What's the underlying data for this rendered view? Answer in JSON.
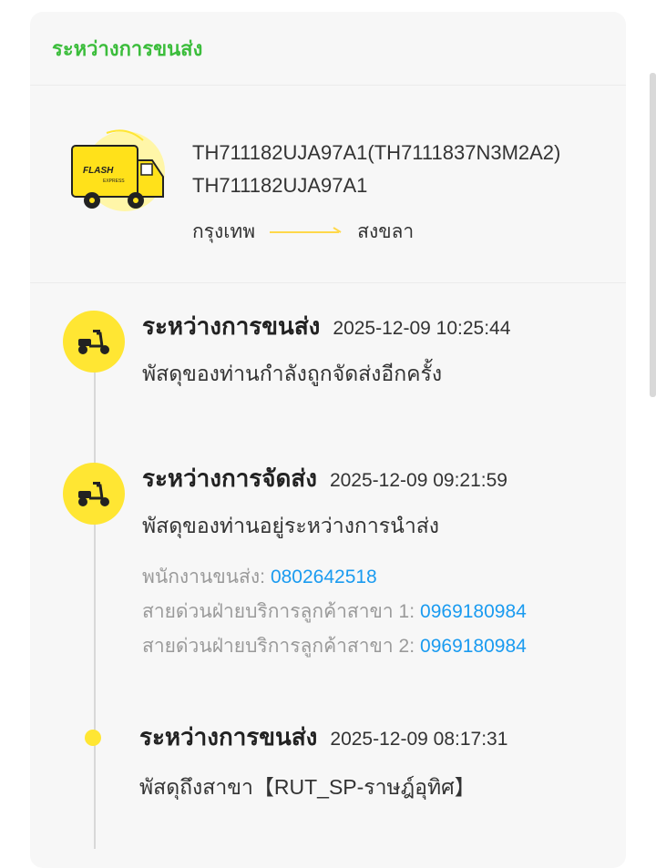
{
  "header": {
    "title": "ระหว่างการขนส่ง"
  },
  "shipment": {
    "tracking_line1": "TH711182UJA97A1(TH7111837N3M2A2)",
    "tracking_line2": "TH711182UJA97A1",
    "origin": "กรุงเทพ",
    "destination": "สงขลา",
    "truck_icon": "flash-delivery-truck-icon"
  },
  "events": [
    {
      "status": "ระหว่างการขนส่ง",
      "time": "2025-12-09  10:25:44",
      "desc": "พัสดุของท่านกำลังถูกจัดส่งอีกครั้ง",
      "icon": "scooter-icon"
    },
    {
      "status": "ระหว่างการจัดส่ง",
      "time": "2025-12-09  09:21:59",
      "desc": "พัสดุของท่านอยู่ระหว่างการนำส่ง",
      "icon": "scooter-icon",
      "contacts": [
        {
          "label": "พนักงานขนส่ง:",
          "phone": "0802642518"
        },
        {
          "label": "สายด่วนฝ่ายบริการลูกค้าสาขา  1:",
          "phone": "0969180984"
        },
        {
          "label": "สายด่วนฝ่ายบริการลูกค้าสาขา  2:",
          "phone": "0969180984"
        }
      ]
    },
    {
      "status": "ระหว่างการขนส่ง",
      "time": "2025-12-09  08:17:31",
      "desc": "พัสดุถึงสาขา【RUT_SP-ราษฎ์อุทิศ】",
      "icon": "dot"
    }
  ],
  "colors": {
    "accent_green": "#3cbd3c",
    "yellow": "#ffe633",
    "link_blue": "#1a9bf0"
  }
}
